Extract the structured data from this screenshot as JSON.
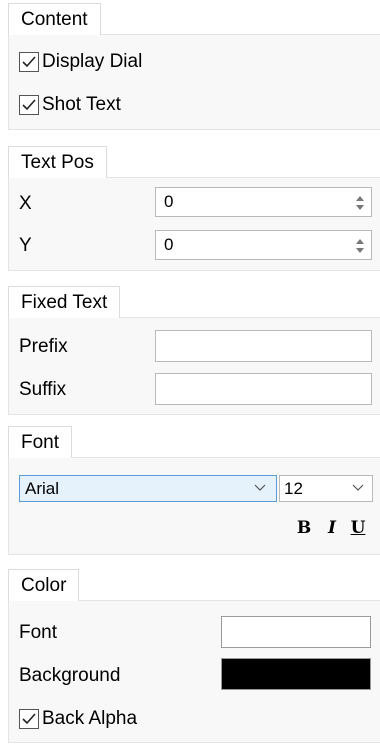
{
  "content": {
    "tab_label": "Content",
    "display_dial": {
      "label": "Display Dial",
      "checked": true
    },
    "shot_text": {
      "label": "Shot Text",
      "checked": true
    }
  },
  "text_pos": {
    "tab_label": "Text Pos",
    "x_label": "X",
    "x_value": "0",
    "y_label": "Y",
    "y_value": "0"
  },
  "fixed_text": {
    "tab_label": "Fixed Text",
    "prefix_label": "Prefix",
    "prefix_value": "",
    "suffix_label": "Suffix",
    "suffix_value": ""
  },
  "font": {
    "tab_label": "Font",
    "family": "Arial",
    "size": "12",
    "bold_label": "B",
    "italic_label": "I",
    "underline_label": "U"
  },
  "color": {
    "tab_label": "Color",
    "font_label": "Font",
    "font_color": "#ffffff",
    "background_label": "Background",
    "background_color": "#000000",
    "back_alpha": {
      "label": "Back Alpha",
      "checked": true
    }
  },
  "theme": {
    "select_highlight": "#e5f1fb",
    "select_border": "#5b9bd5",
    "panel_bg": "#f8f8f8"
  }
}
